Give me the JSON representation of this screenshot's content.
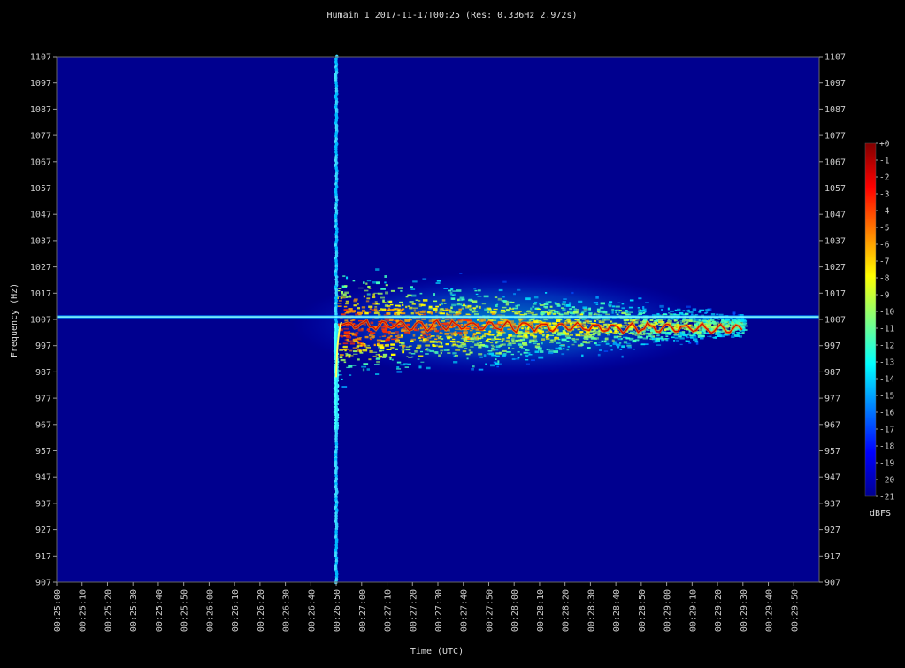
{
  "chart_data": {
    "type": "heatmap",
    "title": "Humain 1 2017-11-17T00:25 (Res: 0.336Hz 2.972s)",
    "xlabel": "Time (UTC)",
    "ylabel": "Frequency (Hz)",
    "y_ticks": [
      1107,
      1097,
      1087,
      1077,
      1067,
      1057,
      1047,
      1037,
      1027,
      1017,
      1007,
      997,
      987,
      977,
      967,
      957,
      947,
      937,
      927,
      917,
      907
    ],
    "ylim": [
      907,
      1107
    ],
    "x_ticks": [
      "00:25:00",
      "00:25:10",
      "00:25:20",
      "00:25:30",
      "00:25:40",
      "00:25:50",
      "00:26:00",
      "00:26:10",
      "00:26:20",
      "00:26:30",
      "00:26:40",
      "00:26:50",
      "00:27:00",
      "00:27:10",
      "00:27:20",
      "00:27:30",
      "00:27:40",
      "00:27:50",
      "00:28:00",
      "00:28:10",
      "00:28:20",
      "00:28:30",
      "00:28:40",
      "00:28:50",
      "00:29:00",
      "00:29:10",
      "00:29:20",
      "00:29:30",
      "00:29:40",
      "00:29:50"
    ],
    "xlim": [
      "00:25:00",
      "00:30:00"
    ],
    "colorbar": {
      "label": "dBFS",
      "ticks": [
        "+0",
        "-1",
        "-2",
        "-3",
        "-4",
        "-5",
        "-6",
        "-7",
        "-8",
        "-9",
        "-10",
        "-11",
        "-12",
        "-13",
        "-14",
        "-15",
        "-16",
        "-17",
        "-18",
        "-19",
        "-20",
        "-21"
      ],
      "range": [
        -21,
        0
      ]
    },
    "background_level_dbfs": -21,
    "carrier": {
      "frequency_hz": 1008,
      "level_dbfs": -15
    },
    "meteor_trail": {
      "time": "00:26:50",
      "head_echo_freq_range_hz": [
        907,
        1107
      ],
      "echo_center_freq_hz": 1005,
      "echo_start": "00:26:50",
      "echo_end": "00:29:30",
      "peak_level_dbfs": -2
    },
    "colors": {
      "background": "#000000",
      "plot_background": "#00008f",
      "text": "#dddddd",
      "carrier": "#7fffff"
    }
  }
}
